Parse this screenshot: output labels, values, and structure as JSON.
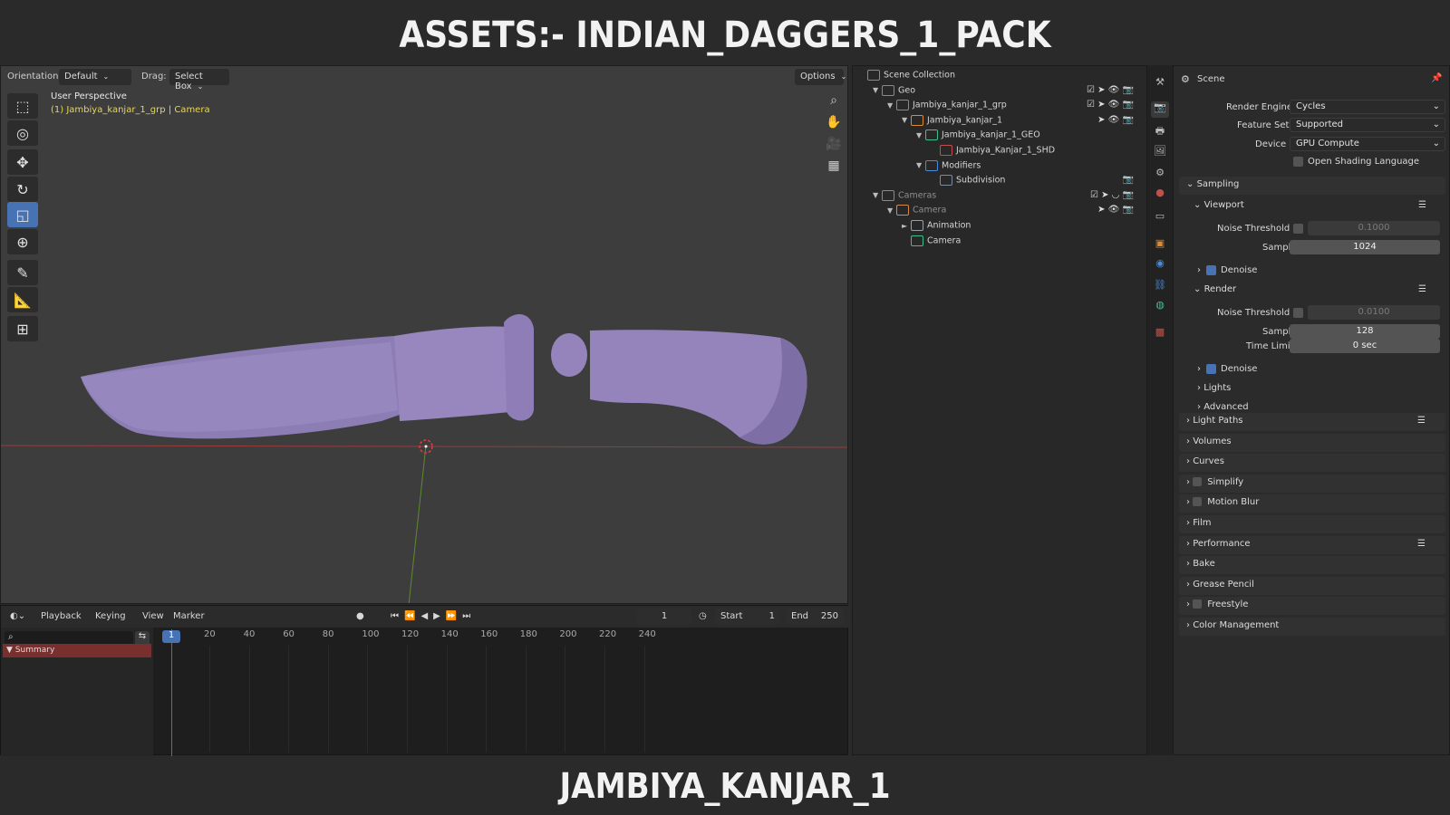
{
  "title_top": "ASSETS:- INDIAN_DAGGERS_1_PACK",
  "title_bottom": "JAMBIYA_KANJAR_1",
  "viewport": {
    "orientation_label": "Orientation:",
    "orientation_value": "Default",
    "drag_label": "Drag:",
    "drag_value": "Select Box",
    "options_label": "Options",
    "perspective": "User Perspective",
    "object_info": "(1) Jambiya_kanjar_1_grp | Camera"
  },
  "timeline": {
    "menus": [
      "Playback",
      "Keying",
      "View",
      "Marker"
    ],
    "current_frame": "1",
    "start_label": "Start",
    "start_value": "1",
    "end_label": "End",
    "end_value": "250",
    "ruler": [
      "1",
      "20",
      "40",
      "60",
      "80",
      "100",
      "120",
      "140",
      "160",
      "180",
      "200",
      "220",
      "240"
    ],
    "summary": "Summary"
  },
  "outliner": {
    "rows": [
      {
        "label": "Scene Collection",
        "indent": 0,
        "icon": "collection",
        "twisty": ""
      },
      {
        "label": "Geo",
        "indent": 1,
        "icon": "collection",
        "twisty": "▼"
      },
      {
        "label": "Jambiya_kanjar_1_grp",
        "indent": 2,
        "icon": "collection",
        "twisty": "▼"
      },
      {
        "label": "Jambiya_kanjar_1",
        "indent": 3,
        "icon": "object",
        "twisty": "▼"
      },
      {
        "label": "Jambiya_kanjar_1_GEO",
        "indent": 4,
        "icon": "mesh",
        "twisty": "▼"
      },
      {
        "label": "Jambiya_Kanjar_1_SHD",
        "indent": 5,
        "icon": "material",
        "twisty": ""
      },
      {
        "label": "Modifiers",
        "indent": 4,
        "icon": "wrench",
        "twisty": "▼"
      },
      {
        "label": "Subdivision",
        "indent": 5,
        "icon": "modifier",
        "twisty": ""
      },
      {
        "label": "Cameras",
        "indent": 1,
        "icon": "collection",
        "twisty": "▼"
      },
      {
        "label": "Camera",
        "indent": 2,
        "icon": "camera-object",
        "twisty": "▼"
      },
      {
        "label": "Animation",
        "indent": 3,
        "icon": "animation",
        "twisty": "►"
      },
      {
        "label": "Camera",
        "indent": 3,
        "icon": "camera-data",
        "twisty": ""
      }
    ]
  },
  "properties": {
    "scene_label": "Scene",
    "render_engine_label": "Render Engine",
    "render_engine_value": "Cycles",
    "feature_set_label": "Feature Set",
    "feature_set_value": "Supported",
    "device_label": "Device",
    "device_value": "GPU Compute",
    "osl_label": "Open Shading Language",
    "sampling": "Sampling",
    "viewport": "Viewport",
    "noise_threshold_label": "Noise Threshold",
    "viewport_noise_value": "0.1000",
    "samples_label": "Samples",
    "viewport_samples_value": "1024",
    "denoise_label": "Denoise",
    "render": "Render",
    "render_noise_value": "0.0100",
    "render_samples_value": "128",
    "time_limit_label": "Time Limit",
    "time_limit_value": "0 sec",
    "lights": "Lights",
    "advanced": "Advanced",
    "panels": [
      "Light Paths",
      "Volumes",
      "Curves",
      "Simplify",
      "Motion Blur",
      "Film",
      "Performance",
      "Bake",
      "Grease Pencil",
      "Freestyle",
      "Color Management"
    ]
  },
  "colors": {
    "accent": "#4772b3",
    "dagger": "#9b8ac0"
  }
}
